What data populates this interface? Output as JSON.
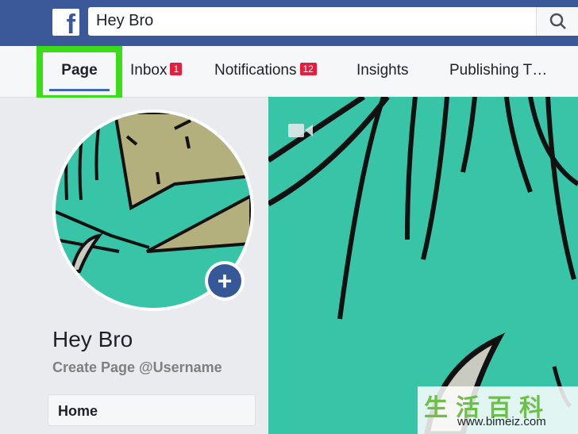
{
  "header": {
    "logo_letter": "f",
    "search_value": "Hey Bro"
  },
  "tabs": [
    {
      "label": "Page"
    },
    {
      "label": "Inbox",
      "badge": "1"
    },
    {
      "label": "Notifications",
      "badge": "12"
    },
    {
      "label": "Insights"
    },
    {
      "label": "Publishing T…"
    }
  ],
  "profile": {
    "name": "Hey Bro",
    "username_link": "Create Page @Username",
    "add_photo_symbol": "+"
  },
  "nav": {
    "home_label": "Home"
  },
  "watermark": {
    "title": "生活百科",
    "url": "www.bimeiz.com"
  },
  "colors": {
    "brand": "#3b5998",
    "highlight": "#3add18",
    "badge": "#e41e3f",
    "cover_bg": "#38c4a6"
  }
}
